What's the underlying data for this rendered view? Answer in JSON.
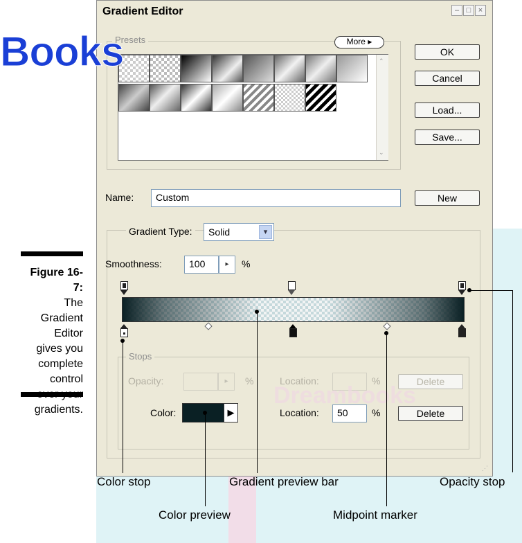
{
  "watermark": {
    "logo": "Books",
    "bottom_text": "Dreambooks"
  },
  "figure": {
    "label": "Figure 16-7:",
    "caption_lines": [
      "The",
      "Gradient",
      "Editor",
      "gives you",
      "complete",
      "control",
      "over your",
      "gradients."
    ]
  },
  "dialog": {
    "title": "Gradient Editor",
    "window_buttons": [
      "minimize",
      "maximize",
      "close"
    ],
    "presets": {
      "legend": "Presets",
      "more_label": "More",
      "swatch_count": 16
    },
    "buttons": {
      "ok": "OK",
      "cancel": "Cancel",
      "load": "Load...",
      "save": "Save...",
      "new": "New"
    },
    "name": {
      "label": "Name:",
      "value": "Custom"
    },
    "gradient": {
      "type_label": "Gradient Type:",
      "type_value": "Solid",
      "smoothness_label": "Smoothness:",
      "smoothness_value": "100",
      "smoothness_unit": "%"
    },
    "stops": {
      "legend": "Stops",
      "opacity_label": "Opacity:",
      "opacity_unit": "%",
      "location_label_top": "Location:",
      "location_unit_top": "%",
      "delete_top": "Delete",
      "color_label": "Color:",
      "color_value": "#0a2024",
      "location_label": "Location:",
      "location_value": "50",
      "location_unit": "%",
      "delete": "Delete"
    }
  },
  "callouts": {
    "color_stop": "Color stop",
    "preview_bar": "Gradient preview bar",
    "opacity_stop": "Opacity stop",
    "color_preview": "Color preview",
    "midpoint": "Midpoint marker"
  },
  "colors": {
    "accent_watermark": "#1a3fd6",
    "gradient_dark": "#0a2024",
    "dialog_bg": "#ece9d8"
  }
}
